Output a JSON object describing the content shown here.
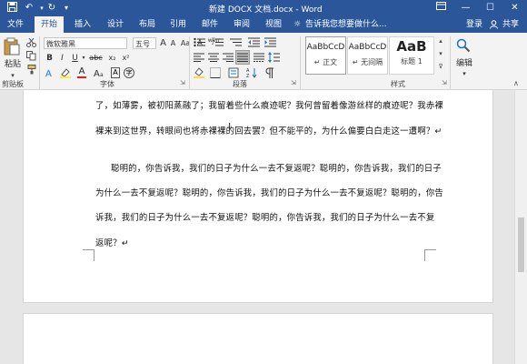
{
  "window": {
    "title": "新建 DOCX 文档.docx - Word",
    "min_glyph": "—",
    "max_glyph": "☐",
    "close_glyph": "✕",
    "accent": "#2b579a"
  },
  "quick_access": {
    "save_icon": "save-icon",
    "undo_icon": "undo-icon",
    "redo_icon": "redo-icon",
    "customize_icon": "customize-icon"
  },
  "tabs": [
    {
      "label": "文件"
    },
    {
      "label": "开始",
      "active": true
    },
    {
      "label": "插入"
    },
    {
      "label": "设计"
    },
    {
      "label": "布局"
    },
    {
      "label": "引用"
    },
    {
      "label": "邮件"
    },
    {
      "label": "审阅"
    },
    {
      "label": "视图"
    }
  ],
  "tell_me": "告诉我您想要做什么...",
  "signin": "登录",
  "share": "共享",
  "ribbon": {
    "clipboard": {
      "paste": "粘贴",
      "label": "剪贴板"
    },
    "font": {
      "name": "微软雅黑",
      "size": "五号",
      "label": "字体",
      "bold": "B",
      "italic": "I",
      "underline": "U",
      "strike": "abc",
      "sub": "x₂",
      "sup": "x²",
      "grow": "A",
      "wen": "wén",
      "clear": "A",
      "case": "Aa",
      "color_a": "A",
      "char_a": "A"
    },
    "paragraph": {
      "label": "段落"
    },
    "styles": {
      "label": "样式",
      "items": [
        {
          "sample": "AaBbCcD",
          "name": "↵ 正文"
        },
        {
          "sample": "AaBbCcD",
          "name": "↵ 无间隔"
        },
        {
          "sample": "AaB",
          "name": "标题 1"
        }
      ]
    },
    "editing": {
      "label": "编辑"
    }
  },
  "document": {
    "lines": [
      "了，如薄雾，被初阳蒸融了；我留着些什么痕迹呢？我何曾留着像游丝样的痕迹呢？我赤裸",
      "裸来到这世界，转眼间也将赤裸裸的回去罢？但不能平的，为什么偏要白白走这一遭啊？↵",
      "聪明的，你告诉我，我们的日子为什么一去不复返呢？聪明的，你告诉我，我们的日子",
      "为什么一去不复返呢？聪明的，你告诉我，我们的日子为什么一去不复返呢？聪明的，你告",
      "诉我，我们的日子为什么一去不复返呢？聪明的，你告诉我，我们的日子为什么一去不复",
      "返呢？↵"
    ]
  }
}
